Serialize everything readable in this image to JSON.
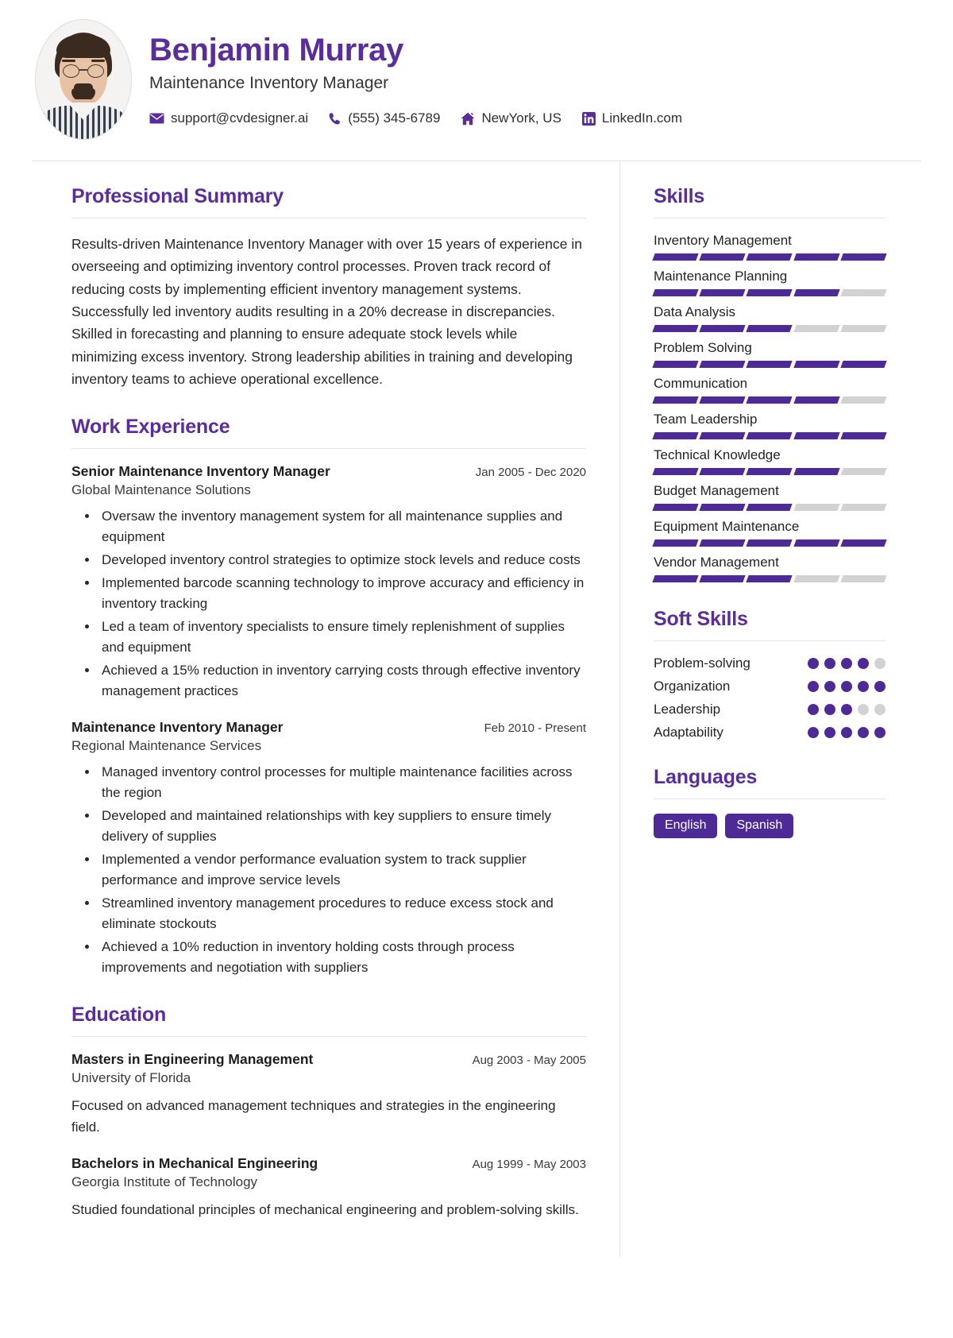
{
  "header": {
    "name": "Benjamin Murray",
    "job_title": "Maintenance Inventory Manager",
    "avatar_alt": "profile-photo",
    "contacts": [
      {
        "icon": "envelope-icon",
        "text": "support@cvdesigner.ai"
      },
      {
        "icon": "phone-icon",
        "text": "(555) 345-6789"
      },
      {
        "icon": "home-icon",
        "text": "NewYork, US"
      },
      {
        "icon": "linkedin-icon",
        "text": "LinkedIn.com"
      }
    ]
  },
  "left": {
    "summary": {
      "title": "Professional Summary",
      "text": "Results-driven Maintenance Inventory Manager with over 15 years of experience in overseeing and optimizing inventory control processes. Proven track record of reducing costs by implementing efficient inventory management systems. Successfully led inventory audits resulting in a 20% decrease in discrepancies. Skilled in forecasting and planning to ensure adequate stock levels while minimizing excess inventory. Strong leadership abilities in training and developing inventory teams to achieve operational excellence."
    },
    "work": {
      "title": "Work Experience",
      "entries": [
        {
          "role": "Senior Maintenance Inventory Manager",
          "date": "Jan 2005 - Dec 2020",
          "org": "Global Maintenance Solutions",
          "bullets": [
            "Oversaw the inventory management system for all maintenance supplies and equipment",
            "Developed inventory control strategies to optimize stock levels and reduce costs",
            "Implemented barcode scanning technology to improve accuracy and efficiency in inventory tracking",
            "Led a team of inventory specialists to ensure timely replenishment of supplies and equipment",
            "Achieved a 15% reduction in inventory carrying costs through effective inventory management practices"
          ]
        },
        {
          "role": "Maintenance Inventory Manager",
          "date": "Feb 2010 - Present",
          "org": "Regional Maintenance Services",
          "bullets": [
            "Managed inventory control processes for multiple maintenance facilities across the region",
            "Developed and maintained relationships with key suppliers to ensure timely delivery of supplies",
            "Implemented a vendor performance evaluation system to track supplier performance and improve service levels",
            "Streamlined inventory management procedures to reduce excess stock and eliminate stockouts",
            "Achieved a 10% reduction in inventory holding costs through process improvements and negotiation with suppliers"
          ]
        }
      ]
    },
    "education": {
      "title": "Education",
      "entries": [
        {
          "degree": "Masters in Engineering Management",
          "date": "Aug 2003 - May 2005",
          "school": "University of Florida",
          "description": "Focused on advanced management techniques and strategies in the engineering field."
        },
        {
          "degree": "Bachelors in Mechanical Engineering",
          "date": "Aug 1999 - May 2003",
          "school": "Georgia Institute of Technology",
          "description": "Studied foundational principles of mechanical engineering and problem-solving skills."
        }
      ]
    }
  },
  "right": {
    "skills": {
      "title": "Skills",
      "max_level": 5,
      "items": [
        {
          "name": "Inventory Management",
          "level": 5
        },
        {
          "name": "Maintenance Planning",
          "level": 4
        },
        {
          "name": "Data Analysis",
          "level": 3
        },
        {
          "name": "Problem Solving",
          "level": 5
        },
        {
          "name": "Communication",
          "level": 4
        },
        {
          "name": "Team Leadership",
          "level": 5
        },
        {
          "name": "Technical Knowledge",
          "level": 4
        },
        {
          "name": "Budget Management",
          "level": 3
        },
        {
          "name": "Equipment Maintenance",
          "level": 5
        },
        {
          "name": "Vendor Management",
          "level": 3
        }
      ]
    },
    "soft_skills": {
      "title": "Soft Skills",
      "max_level": 5,
      "items": [
        {
          "name": "Problem-solving",
          "level": 4
        },
        {
          "name": "Organization",
          "level": 5
        },
        {
          "name": "Leadership",
          "level": 3
        },
        {
          "name": "Adaptability",
          "level": 5
        }
      ]
    },
    "languages": {
      "title": "Languages",
      "items": [
        "English",
        "Spanish"
      ]
    }
  },
  "colors": {
    "accent": "#5b2d9b",
    "bar_on": "#4e2a96",
    "bar_off": "#d2d2d2",
    "text": "#262626",
    "rule": "#e4e4e4"
  }
}
